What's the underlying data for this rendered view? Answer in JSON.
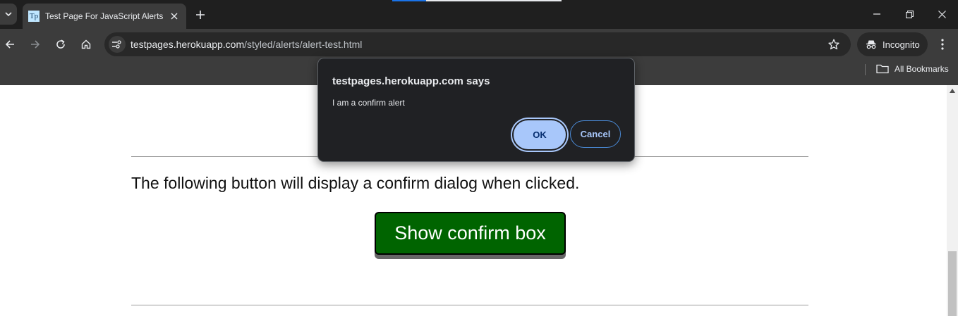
{
  "browser": {
    "tab_title": "Test Page For JavaScript Alerts",
    "favicon_text": "Tp",
    "url_host": "testpages.herokuapp.com",
    "url_path": "/styled/alerts/alert-test.html",
    "incognito_label": "Incognito",
    "all_bookmarks_label": "All Bookmarks"
  },
  "page": {
    "explanation": "The following button will display a confirm dialog when clicked.",
    "confirm_button_label": "Show confirm box"
  },
  "dialog": {
    "title": "testpages.herokuapp.com says",
    "message": "I am a confirm alert",
    "ok_label": "OK",
    "cancel_label": "Cancel"
  },
  "colors": {
    "confirm_button_bg": "#006400",
    "dialog_bg": "#202124",
    "dialog_primary": "#a8c7fa",
    "chrome_dark": "#1f1f1f"
  },
  "icons": [
    "tab-search-icon",
    "close-icon",
    "plus-icon",
    "minimize-icon",
    "restore-icon",
    "back-icon",
    "forward-icon",
    "reload-icon",
    "home-icon",
    "site-info-icon",
    "star-icon",
    "incognito-icon",
    "kebab-menu-icon",
    "folder-icon"
  ]
}
